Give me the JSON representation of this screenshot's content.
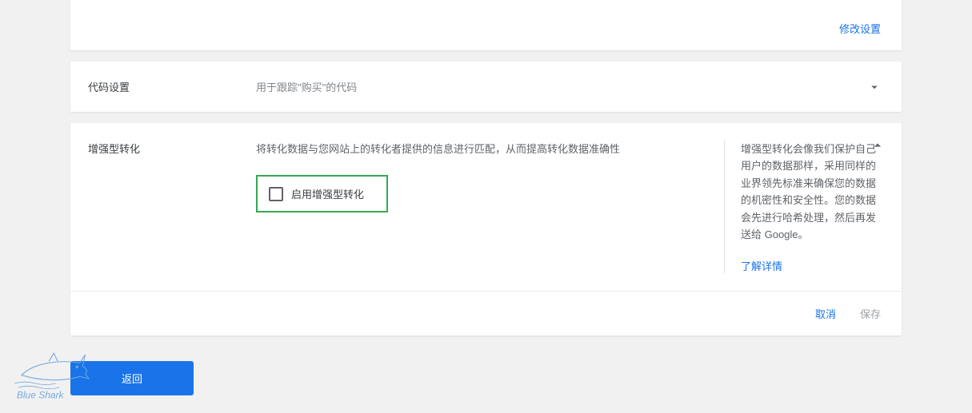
{
  "top_card": {
    "modify_link": "修改设置"
  },
  "code_settings": {
    "title": "代码设置",
    "subtitle": "用于跟踪\"购买\"的代码"
  },
  "enhanced": {
    "title": "增强型转化",
    "description": "将转化数据与您网站上的转化者提供的信息进行匹配，从而提高转化数据准确性",
    "checkbox_label": "启用增强型转化",
    "info_text": "增强型转化会像我们保护自己用户的数据那样，采用同样的业界领先标准来确保您的数据的机密性和安全性。您的数据会先进行哈希处理，然后再发送给 Google。",
    "learn_more": "了解详情",
    "cancel": "取消",
    "save": "保存"
  },
  "back_button": "返回",
  "watermark": "Blue Shark"
}
